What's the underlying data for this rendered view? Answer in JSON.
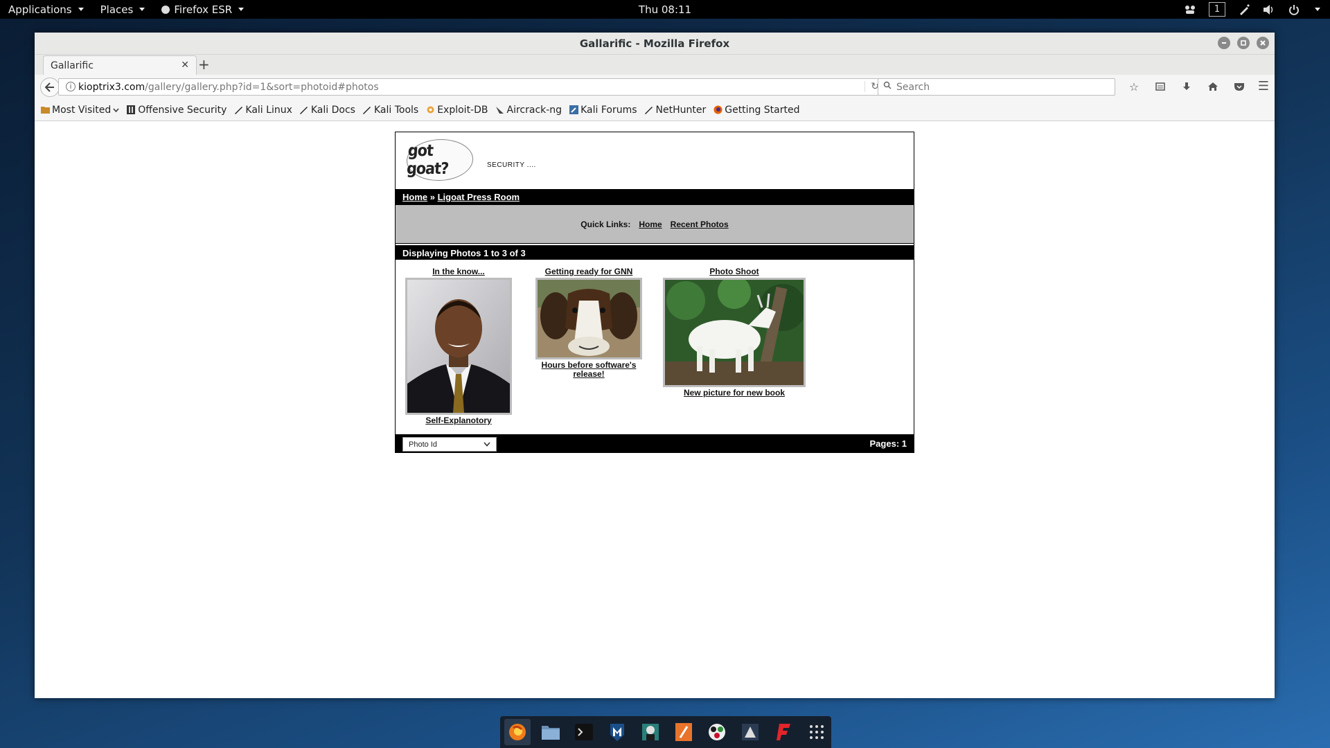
{
  "topbar": {
    "applications_label": "Applications",
    "places_label": "Places",
    "firefox_label": "Firefox ESR",
    "clock": "Thu 08:11",
    "workspace_number": "1"
  },
  "window": {
    "title": "Gallarific - Mozilla Firefox"
  },
  "tab": {
    "title": "Gallarific"
  },
  "urlbar": {
    "host": "kioptrix3.com",
    "path": "/gallery/gallery.php?id=1&sort=photoid#photos"
  },
  "search": {
    "placeholder": "Search"
  },
  "bookmarks": [
    {
      "label": "Most Visited",
      "icon": "folder-icon"
    },
    {
      "label": "Offensive Security",
      "icon": "offsec-icon"
    },
    {
      "label": "Kali Linux",
      "icon": "kali-icon"
    },
    {
      "label": "Kali Docs",
      "icon": "kali-icon"
    },
    {
      "label": "Kali Tools",
      "icon": "kali-icon"
    },
    {
      "label": "Exploit-DB",
      "icon": "exploitdb-icon"
    },
    {
      "label": "Aircrack-ng",
      "icon": "aircrack-icon"
    },
    {
      "label": "Kali Forums",
      "icon": "forums-icon"
    },
    {
      "label": "NetHunter",
      "icon": "kali-icon"
    },
    {
      "label": "Getting Started",
      "icon": "firefox-icon"
    }
  ],
  "gallery": {
    "logo_text": "got goat?",
    "slogan": "SECURITY ....",
    "breadcrumb": {
      "home": "Home",
      "separator": "»",
      "current": "Ligoat Press Room"
    },
    "quicklinks": {
      "label": "Quick Links:",
      "home": "Home",
      "recent": "Recent Photos"
    },
    "displaying": "Displaying Photos 1 to 3 of 3",
    "photos": [
      {
        "title": "In the know...",
        "description": "Self-Explanotory"
      },
      {
        "title": "Getting ready for GNN",
        "description": "Hours before software's release!"
      },
      {
        "title": "Photo Shoot",
        "description": "New picture for new book"
      }
    ],
    "sort_selected": "Photo Id",
    "pages": "Pages: 1"
  },
  "dock": [
    "firefox-icon",
    "files-icon",
    "terminal-icon",
    "metasploit-icon",
    "armitage-icon",
    "burpsuite-icon",
    "maltego-icon",
    "beef-icon",
    "faraday-icon",
    "app-grid-icon"
  ]
}
